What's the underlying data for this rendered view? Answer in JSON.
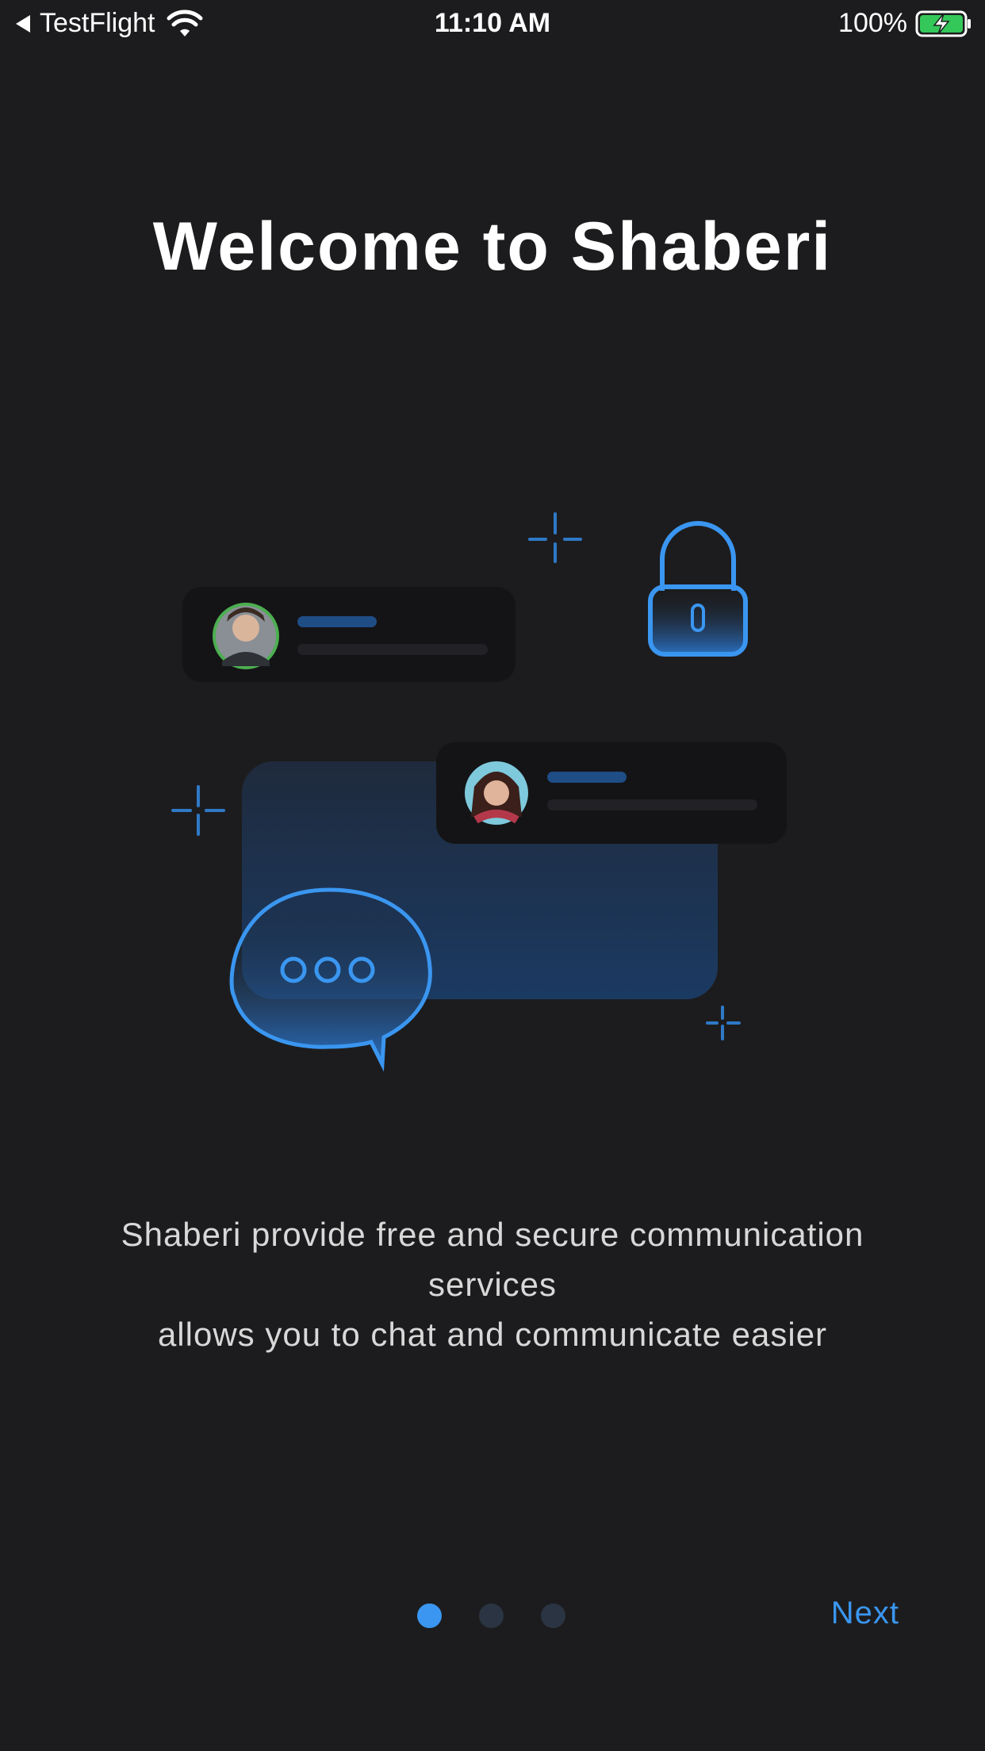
{
  "status_bar": {
    "back_app": "TestFlight",
    "time": "11:10 AM",
    "battery": "100%"
  },
  "title": "Welcome to Shaberi",
  "description": {
    "line1": "Shaberi provide free and secure communication",
    "line2": "services",
    "line3": "allows you to chat and communicate easier"
  },
  "pager": {
    "total": 3,
    "active_index": 0
  },
  "next_label": "Next",
  "colors": {
    "background": "#1c1c1e",
    "accent": "#3a96f0",
    "inactive_dot": "#2a3442",
    "online_ring": "#4caf50"
  }
}
